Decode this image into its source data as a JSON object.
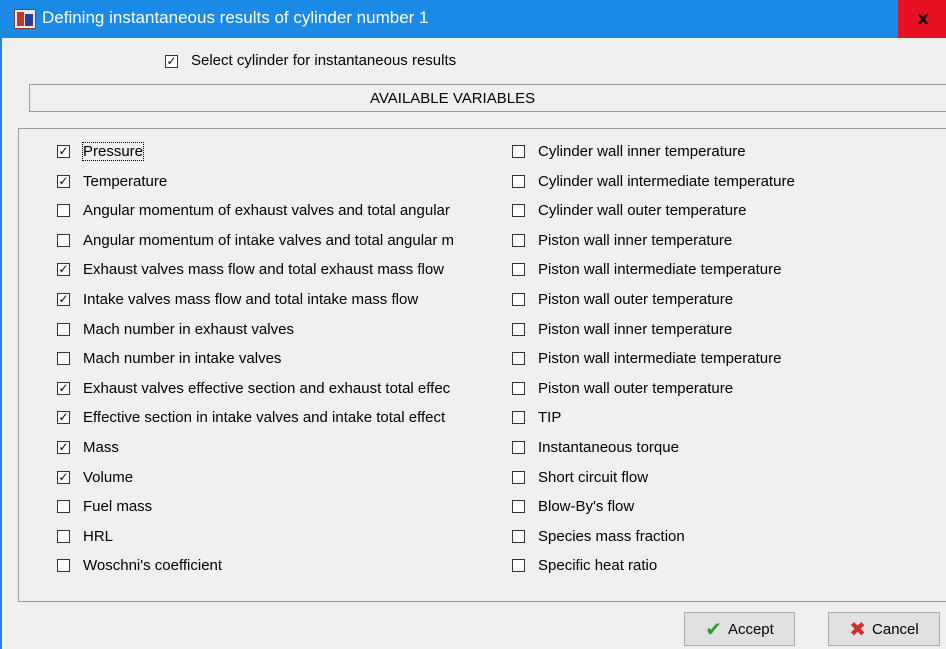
{
  "window": {
    "title": "Defining instantaneous results of cylinder number 1",
    "close_label": "x"
  },
  "select_cylinder": {
    "label": "Select cylinder for instantaneous results",
    "checked": true
  },
  "available_header": "AVAILABLE VARIABLES",
  "variables_left": [
    {
      "label": "Pressure",
      "checked": true
    },
    {
      "label": "Temperature",
      "checked": true
    },
    {
      "label": "Angular momentum of exhaust valves and total angular",
      "checked": false
    },
    {
      "label": "Angular momentum of intake valves and total angular m",
      "checked": false
    },
    {
      "label": "Exhaust valves mass flow and total exhaust mass flow",
      "checked": true
    },
    {
      "label": "Intake valves mass flow and total intake mass flow",
      "checked": true
    },
    {
      "label": "Mach number in exhaust valves",
      "checked": false
    },
    {
      "label": "Mach number in intake valves",
      "checked": false
    },
    {
      "label": "Exhaust valves effective section and exhaust total effec",
      "checked": true
    },
    {
      "label": "Effective section in intake valves and intake total effect",
      "checked": true
    },
    {
      "label": "Mass",
      "checked": true
    },
    {
      "label": "Volume",
      "checked": true
    },
    {
      "label": "Fuel mass",
      "checked": false
    },
    {
      "label": "HRL",
      "checked": false
    },
    {
      "label": "Woschni's coefficient",
      "checked": false
    }
  ],
  "variables_right": [
    {
      "label": "Cylinder wall inner temperature",
      "checked": false
    },
    {
      "label": "Cylinder wall intermediate temperature",
      "checked": false
    },
    {
      "label": "Cylinder wall outer temperature",
      "checked": false
    },
    {
      "label": "Piston wall inner temperature",
      "checked": false
    },
    {
      "label": "Piston wall intermediate temperature",
      "checked": false
    },
    {
      "label": "Piston wall outer temperature",
      "checked": false
    },
    {
      "label": "Piston wall inner temperature",
      "checked": false
    },
    {
      "label": "Piston wall intermediate temperature",
      "checked": false
    },
    {
      "label": "Piston wall outer temperature",
      "checked": false
    },
    {
      "label": "TIP",
      "checked": false
    },
    {
      "label": "Instantaneous torque",
      "checked": false
    },
    {
      "label": "Short circuit flow",
      "checked": false
    },
    {
      "label": "Blow-By's flow",
      "checked": false
    },
    {
      "label": "Species mass fraction",
      "checked": false
    },
    {
      "label": "Specific heat ratio",
      "checked": false
    }
  ],
  "buttons": {
    "accept_label": "Accept",
    "cancel_label": "Cancel",
    "accept_icon": "checkmark-icon",
    "cancel_icon": "cross-icon",
    "accept_icon_color": "#2e9e2e",
    "cancel_icon_color": "#d32f2f"
  },
  "check_glyph": "✓"
}
